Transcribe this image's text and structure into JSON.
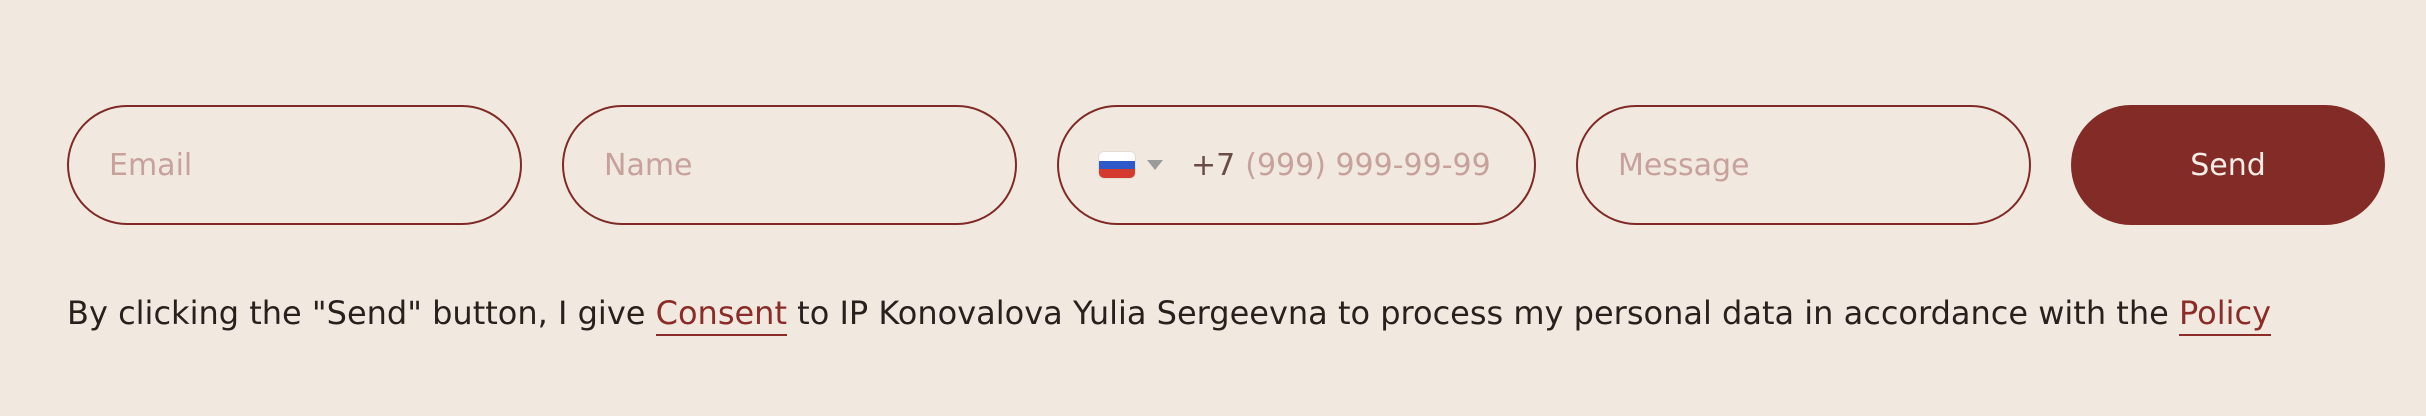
{
  "form": {
    "email": {
      "placeholder": "Email",
      "value": ""
    },
    "name": {
      "placeholder": "Name",
      "value": ""
    },
    "phone": {
      "country_flag": "russia-flag-icon",
      "prefix": "+7",
      "placeholder": "(999) 999-99-99",
      "value": ""
    },
    "message": {
      "placeholder": "Message",
      "value": ""
    },
    "send_label": "Send"
  },
  "consent": {
    "text_before": "By clicking the \"Send\" button, I give ",
    "consent_link": "Consent",
    "text_middle": " to IP Konovalova Yulia Sergeevna to process my personal data in accordance with the ",
    "policy_link": "Policy"
  },
  "colors": {
    "background": "#f1e9df",
    "accent": "#832c27",
    "placeholder": "#c7a19b"
  }
}
